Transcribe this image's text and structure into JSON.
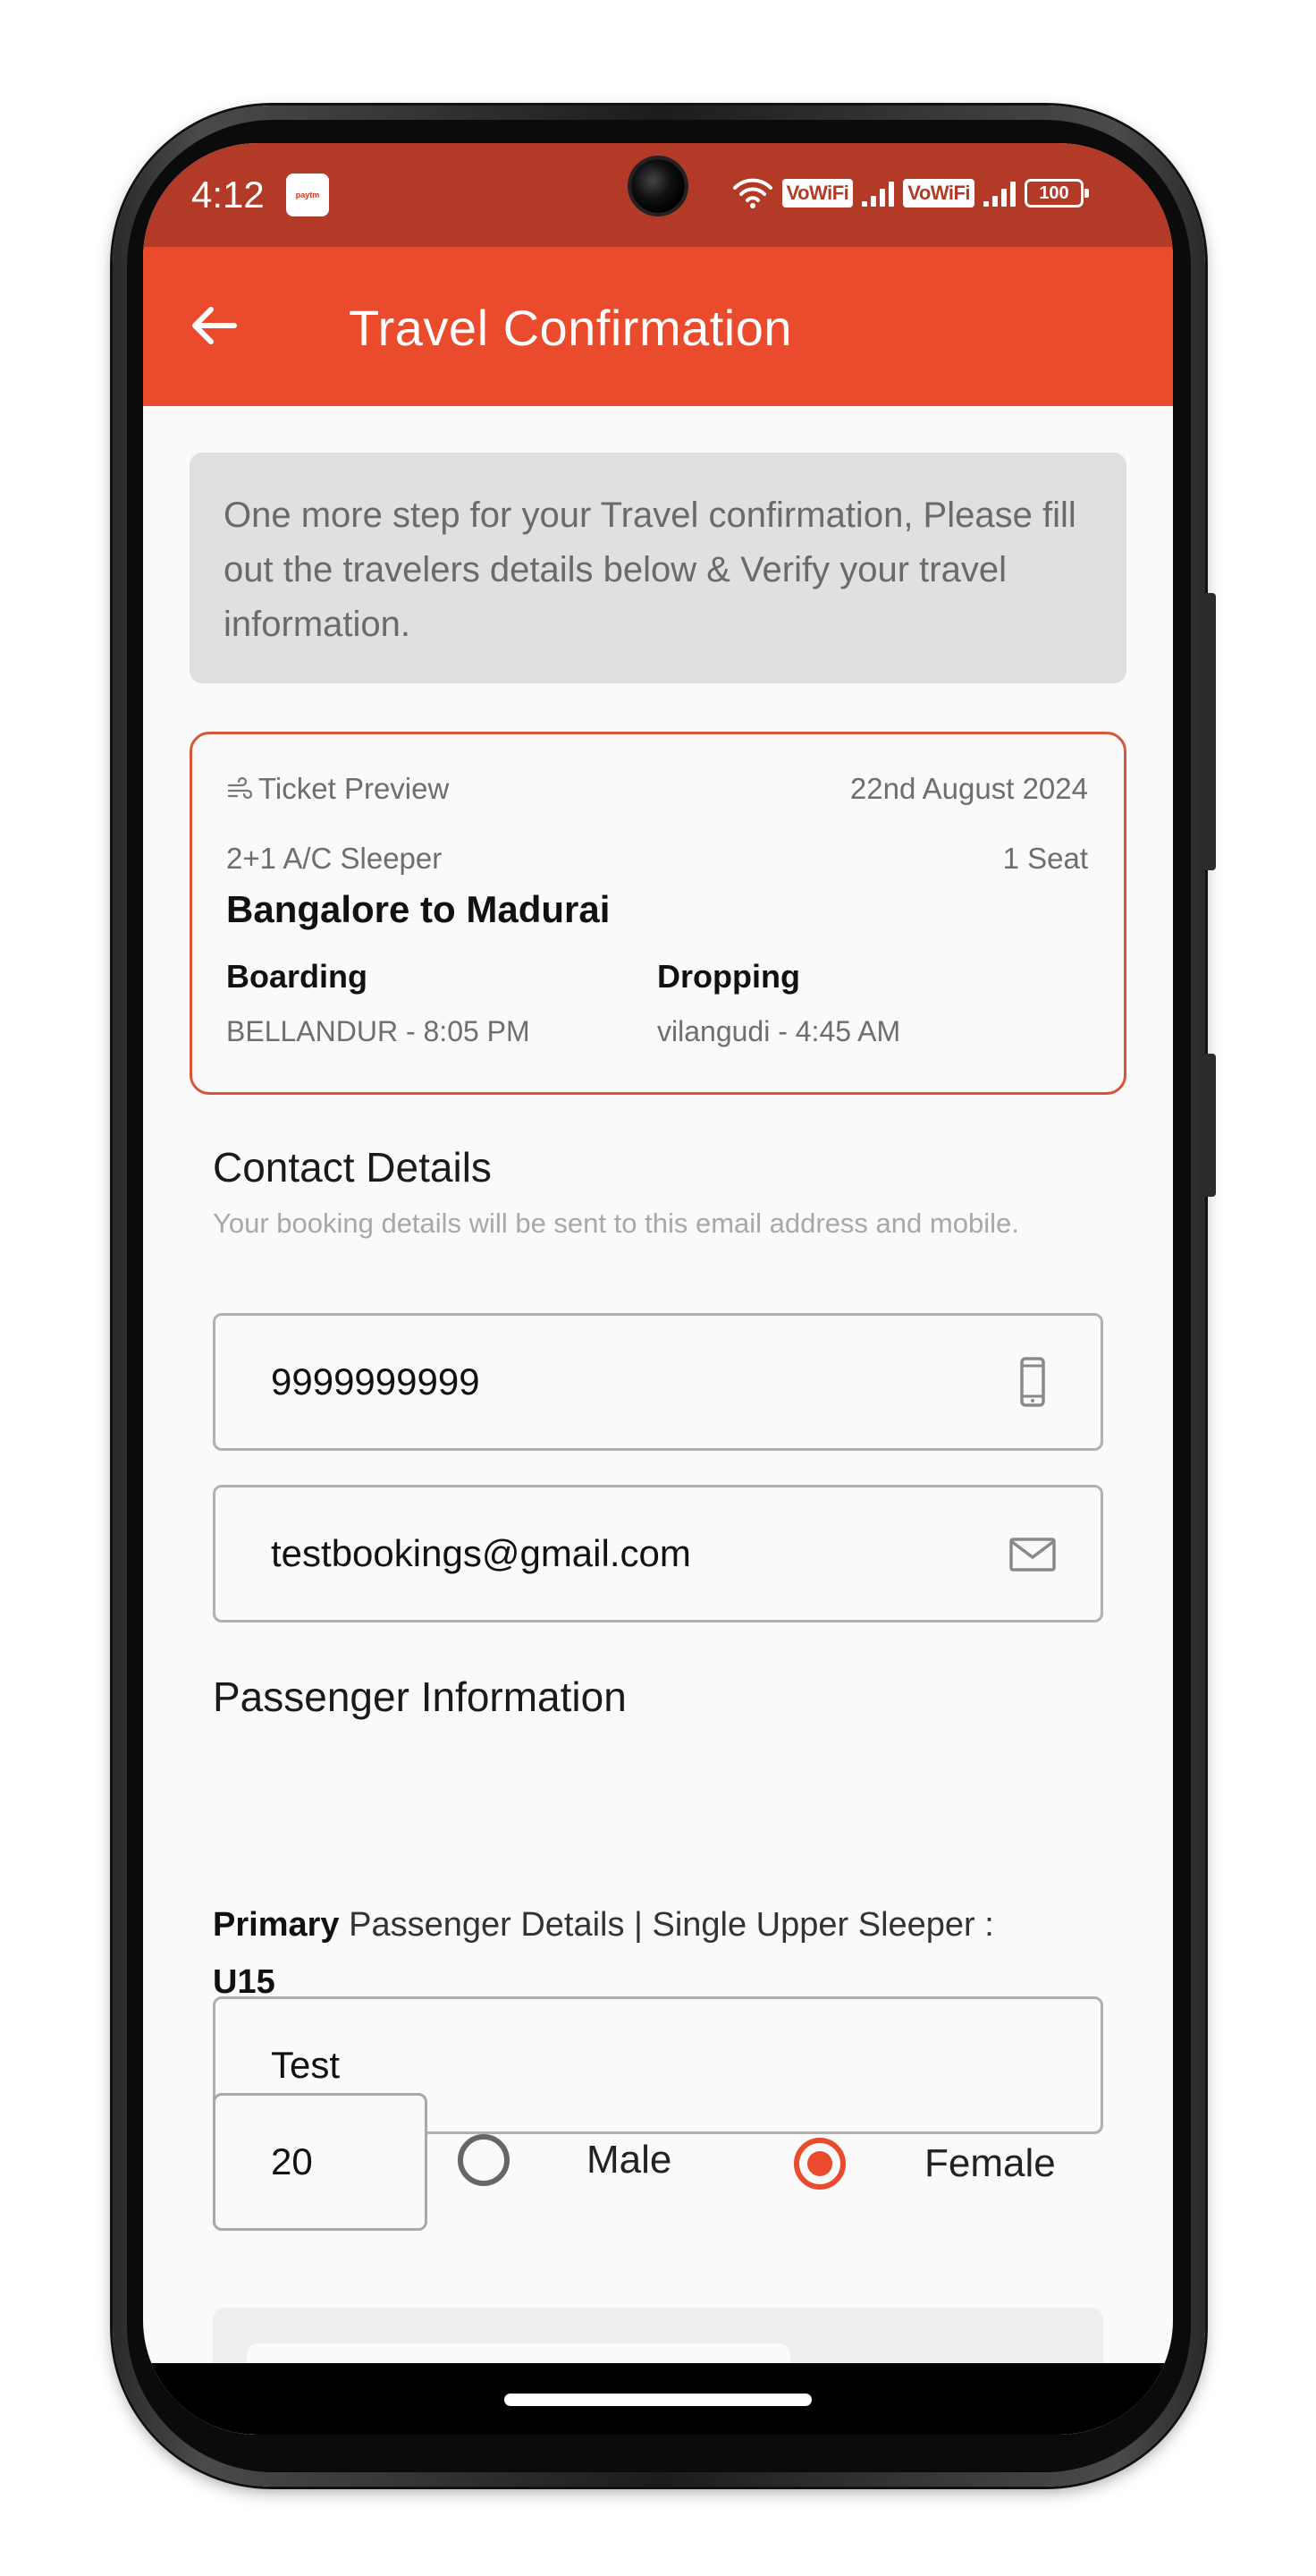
{
  "status_bar": {
    "time": "4:12",
    "app_icon": "paytm",
    "vowifi_1": "VoWiFi",
    "vowifi_2": "VoWiFi",
    "battery": "100"
  },
  "app_bar": {
    "title": "Travel Confirmation",
    "back_icon": "arrow-left-icon"
  },
  "info_message": "One more step for your Travel confirmation, Please fill out the travelers details below & Verify your travel information.",
  "ticket": {
    "preview_label": "Ticket Preview",
    "date": "22nd August 2024",
    "bus_type": "2+1 A/C Sleeper",
    "seats": "1 Seat",
    "route": "Bangalore to Madurai",
    "boarding_label": "Boarding",
    "boarding_value": "BELLANDUR - 8:05 PM",
    "dropping_label": "Dropping",
    "dropping_value": "vilangudi - 4:45 AM"
  },
  "contact": {
    "title": "Contact Details",
    "subtitle": "Your booking details will be sent to this email address and mobile.",
    "phone": "9999999999",
    "email": "testbookings@gmail.com"
  },
  "passenger": {
    "title": "Passenger Information",
    "primary_label": "Primary",
    "details_text": "Passenger Details | Single Upper Sleeper :",
    "seat_code": "U15",
    "name": "Test",
    "age": "20",
    "gender_options": [
      "Male",
      "Female"
    ],
    "gender_selected": "Female"
  },
  "colors": {
    "accent": "#e94b2c",
    "status_bar": "#b23a26",
    "ticket_border": "#d9553a"
  }
}
